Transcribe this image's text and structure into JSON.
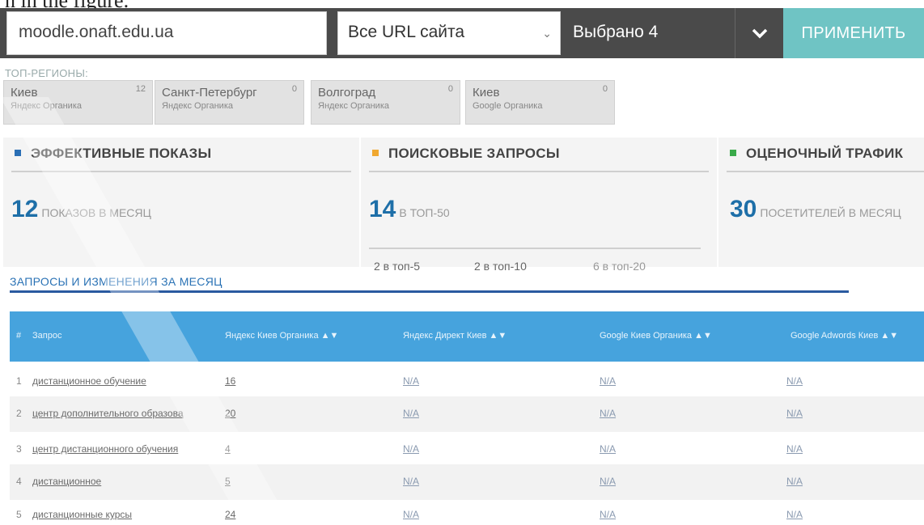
{
  "caption_fragment": "n in the figure.",
  "filter": {
    "url_value": "moodle.onaft.edu.ua",
    "scope_value": "Все URL сайта",
    "selected_label": "Выбрано 4",
    "apply_label": "ПРИМЕНИТЬ"
  },
  "regions": {
    "label": "ТОП-РЕГИОНЫ:",
    "items": [
      {
        "city": "Киев",
        "source": "Яндекс Органика",
        "count": "12"
      },
      {
        "city": "Санкт-Петербург",
        "source": "Яндекс Органика",
        "count": "0"
      },
      {
        "city": "Волгоград",
        "source": "Яндекс Органика",
        "count": "0"
      },
      {
        "city": "Киев",
        "source": "Google Органика",
        "count": "0"
      }
    ]
  },
  "stats": {
    "impressions": {
      "title": "ЭФФЕКТИВНЫЕ ПОКАЗЫ",
      "value": "12",
      "label": "ПОКАЗОВ В МЕСЯЦ",
      "color": "#2a6fb5"
    },
    "queries": {
      "title": "ПОИСКОВЫЕ ЗАПРОСЫ",
      "value": "14",
      "label": "В ТОП-50",
      "color": "#f0a830",
      "top5": "2 в топ-5",
      "top10": "2 в топ-10",
      "top20": "6 в топ-20"
    },
    "traffic": {
      "title": "ОЦЕНОЧНЫЙ ТРАФИК",
      "value": "30",
      "label": "ПОСЕТИТЕЛЕЙ В МЕСЯЦ",
      "color": "#3aaa4a"
    }
  },
  "section": {
    "title": "ЗАПРОСЫ И ИЗМЕНЕНИЯ ЗА МЕСЯЦ"
  },
  "table": {
    "headers": [
      "#",
      "Запрос",
      "Яндекс Киев Органика",
      "Яндекс Директ Киев",
      "Google Киев Органика",
      "Google Adwords Киев"
    ],
    "rows": [
      {
        "num": "1",
        "query": "дистанционное обучение",
        "yandex": "16",
        "direct": "N/A",
        "google": "N/A",
        "adwords": "N/A"
      },
      {
        "num": "2",
        "query": "центр дополнительного образова",
        "yandex": "20",
        "direct": "N/A",
        "google": "N/A",
        "adwords": "N/A"
      },
      {
        "num": "3",
        "query": "центр дистанционного обучения",
        "yandex": "4",
        "direct": "N/A",
        "google": "N/A",
        "adwords": "N/A"
      },
      {
        "num": "4",
        "query": "дистанционное",
        "yandex": "5",
        "direct": "N/A",
        "google": "N/A",
        "adwords": "N/A"
      },
      {
        "num": "5",
        "query": "дистанционные курсы",
        "yandex": "24",
        "direct": "N/A",
        "google": "N/A",
        "adwords": "N/A"
      }
    ]
  }
}
